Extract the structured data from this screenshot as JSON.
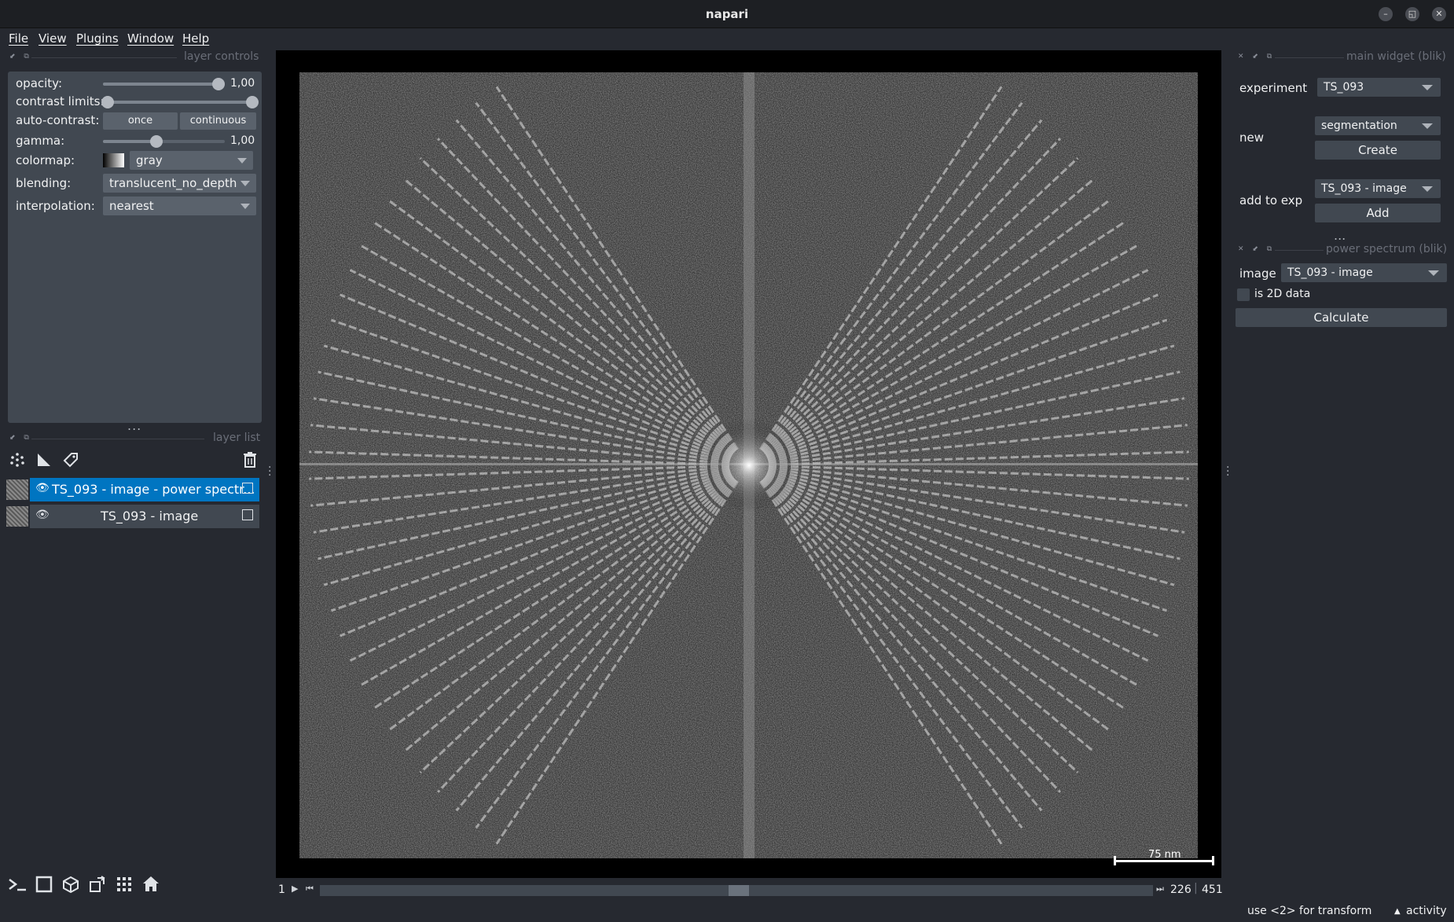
{
  "window": {
    "title": "napari"
  },
  "menu": {
    "file": "File",
    "view": "View",
    "plugins": "Plugins",
    "window": "Window",
    "help": "Help"
  },
  "layer_controls": {
    "dock_title": "layer controls",
    "opacity_label": "opacity:",
    "opacity_value": "1,00",
    "opacity": 1.0,
    "contrast_label": "contrast limits:",
    "contrast_range": [
      0.0,
      1.0
    ],
    "autocontrast_label": "auto-contrast:",
    "once_label": "once",
    "continuous_label": "continuous",
    "gamma_label": "gamma:",
    "gamma_value": "1,00",
    "gamma": 0.44,
    "colormap_label": "colormap:",
    "colormap_value": "gray",
    "blending_label": "blending:",
    "blending_value": "translucent_no_depth",
    "interpolation_label": "interpolation:",
    "interpolation_value": "nearest"
  },
  "layer_list": {
    "dock_title": "layer list",
    "more": "...",
    "layers": [
      {
        "name": "TS_093 - image - power spectr...",
        "selected": true
      },
      {
        "name": "TS_093 - image",
        "selected": false
      }
    ]
  },
  "canvas": {
    "scale_bar": "75 nm"
  },
  "dims": {
    "axis": "1",
    "current": "226",
    "total": "451",
    "position": 0.5
  },
  "main_widget": {
    "dock_title": "main widget (blik)",
    "experiment_label": "experiment",
    "experiment_value": "TS_093",
    "new_label": "new",
    "new_value": "segmentation",
    "create_label": "Create",
    "add_to_exp_label": "add to exp",
    "add_to_exp_value": "TS_093 - image",
    "add_label": "Add",
    "more": "..."
  },
  "power_spectrum": {
    "dock_title": "power spectrum (blik)",
    "image_label": "image",
    "image_value": "TS_093 - image",
    "is2d_label": "is 2D data",
    "calculate_label": "Calculate"
  },
  "status": {
    "hint": "use <2> for transform",
    "activity": "activity"
  },
  "colors": {
    "accent": "#0075c1",
    "panel": "#414851",
    "background": "#262930"
  }
}
